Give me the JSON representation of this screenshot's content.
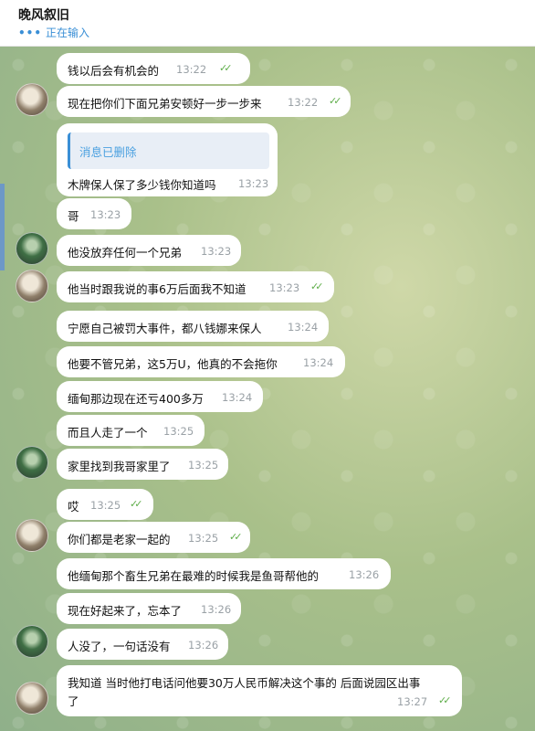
{
  "header": {
    "title": "晚风叙旧",
    "status_dots": "•••",
    "status": "正在输入"
  },
  "messages": [
    {
      "text": "钱以后会有机会的",
      "time": "13:22",
      "read": "✓✓"
    },
    {
      "text": "现在把你们下面兄弟安顿好一步一步来",
      "time": "13:22",
      "read": "✓✓"
    },
    {
      "quote": "消息已删除",
      "text": "木牌保人保了多少钱你知道吗",
      "time": "13:23"
    },
    {
      "text": "哥",
      "time": "13:23"
    },
    {
      "text": "他没放弃任何一个兄弟",
      "time": "13:23"
    },
    {
      "text": "他当时跟我说的事6万后面我不知道",
      "time": "13:23",
      "read": "✓✓"
    },
    {
      "text": "宁愿自己被罚大事件，都八钱娜来保人",
      "time": "13:24"
    },
    {
      "text": "他要不管兄弟，这5万U，他真的不会拖你",
      "time": "13:24"
    },
    {
      "text": "缅甸那边现在还亏400多万",
      "time": "13:24"
    },
    {
      "text": "而且人走了一个",
      "time": "13:25"
    },
    {
      "text": "家里找到我哥家里了",
      "time": "13:25"
    },
    {
      "text": "哎",
      "time": "13:25",
      "read": "✓✓"
    },
    {
      "text": "你们都是老家一起的",
      "time": "13:25",
      "read": "✓✓"
    },
    {
      "text": "他缅甸那个畜生兄弟在最难的时候我是鱼哥帮他的",
      "time": "13:26"
    },
    {
      "text": "现在好起来了，忘本了",
      "time": "13:26"
    },
    {
      "text": "人没了，一句话没有",
      "time": "13:26"
    },
    {
      "text": "我知道  当时他打电话问他要30万人民币解决这个事的  后面说园区出事",
      "text2": "了",
      "time": "13:27",
      "read": "✓✓"
    }
  ]
}
